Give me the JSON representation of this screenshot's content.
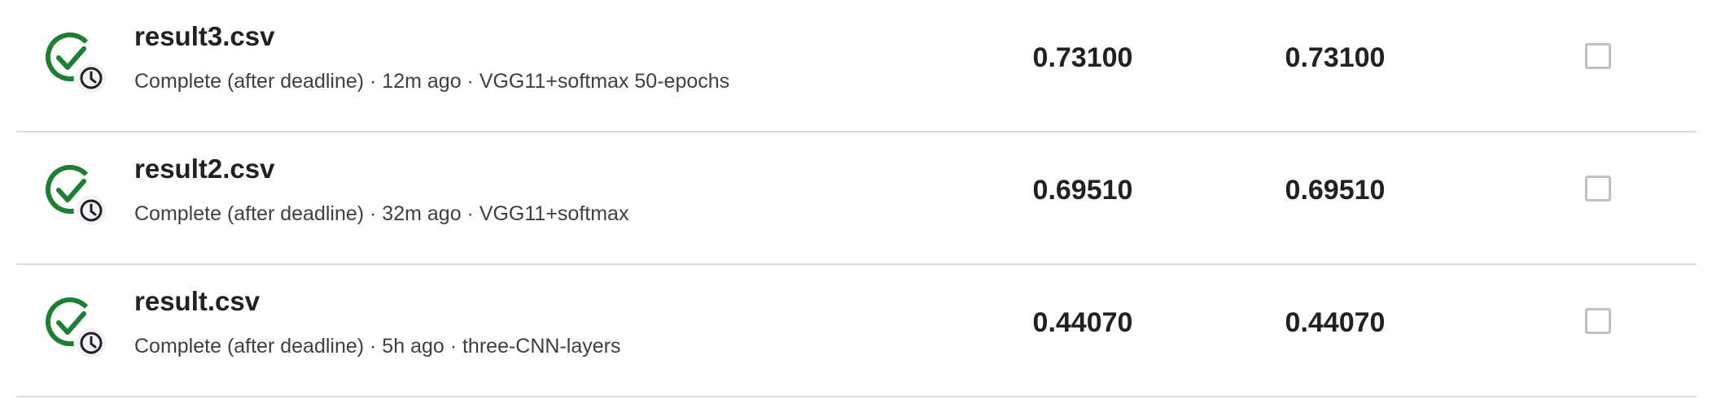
{
  "colors": {
    "success_green": "#1e7e34",
    "divider": "#dadce0",
    "checkbox_border": "#bdc1c6"
  },
  "submissions": [
    {
      "status_icon": "check-with-clock-icon",
      "filename": "result3.csv",
      "meta": "Complete (after deadline) · 12m ago · VGG11+softmax 50-epochs",
      "private_score": "0.73100",
      "public_score": "0.73100",
      "selected": false
    },
    {
      "status_icon": "check-with-clock-icon",
      "filename": "result2.csv",
      "meta": "Complete (after deadline) · 32m ago · VGG11+softmax",
      "private_score": "0.69510",
      "public_score": "0.69510",
      "selected": false
    },
    {
      "status_icon": "check-with-clock-icon",
      "filename": "result.csv",
      "meta": "Complete (after deadline) · 5h ago · three-CNN-layers",
      "private_score": "0.44070",
      "public_score": "0.44070",
      "selected": false
    }
  ]
}
